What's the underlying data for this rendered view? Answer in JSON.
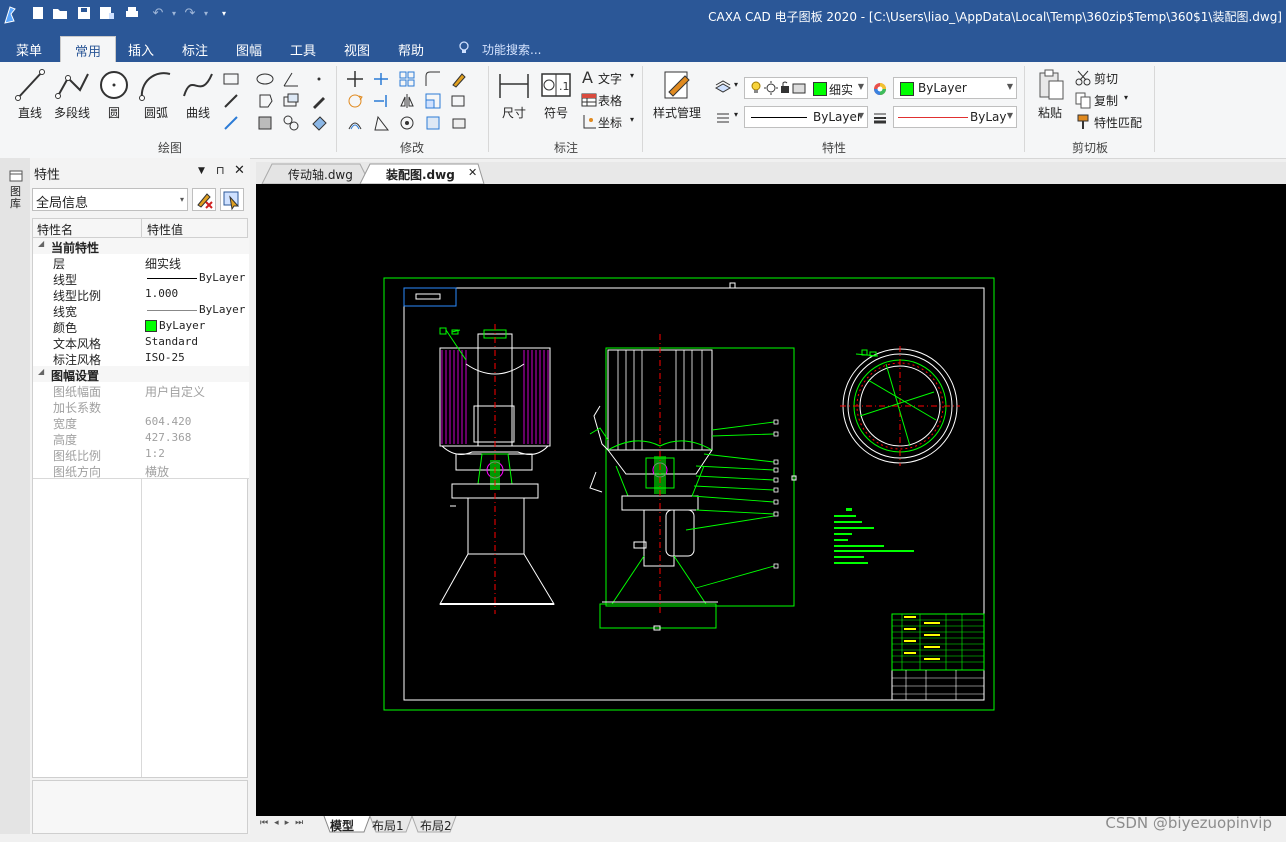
{
  "window": {
    "title": "CAXA CAD 电子图板 2020 - [C:\\Users\\liao_\\AppData\\Local\\Temp\\360zip$Temp\\360$1\\装配图.dwg]"
  },
  "quick_access": [
    "app-logo-icon",
    "new-file-icon",
    "open-folder-icon",
    "save-icon",
    "save-as-icon",
    "print-icon",
    "undo-icon",
    "redo-icon",
    "customize-icon"
  ],
  "menu": {
    "items": [
      "菜单",
      "常用",
      "插入",
      "标注",
      "图幅",
      "工具",
      "视图",
      "帮助"
    ],
    "active": "常用",
    "search_label": "功能搜索..."
  },
  "ribbon": {
    "draw": {
      "label": "绘图",
      "line": "直线",
      "polyline": "多段线",
      "circle": "圆",
      "arc": "圆弧",
      "curve": "曲线"
    },
    "modify": {
      "label": "修改"
    },
    "annotate": {
      "label": "标注",
      "dimension": "尺寸",
      "symbol": "符号",
      "text": "文字",
      "table": "表格",
      "coord": "坐标"
    },
    "properties": {
      "label": "特性",
      "style_manager": "样式管理",
      "layer_name": "细实",
      "color": "ByLayer",
      "linetype": "ByLayer",
      "lineweight": "ByLay"
    },
    "clipboard": {
      "label": "剪切板",
      "paste": "粘贴",
      "cut": "剪切",
      "copy": "复制",
      "match": "特性匹配"
    }
  },
  "colors": {
    "accent": "#2b5797",
    "cad_green": "#00ff00",
    "cad_magenta": "#ff00ff",
    "cad_red": "#ff0000",
    "cad_white": "#ffffff"
  },
  "left_strip": {
    "label": "图库"
  },
  "panel": {
    "title": "特性",
    "filter": "全局信息",
    "col_name": "特性名",
    "col_value": "特性值",
    "rows": [
      {
        "name": "当前特性",
        "value": ""
      },
      {
        "name": "层",
        "value": "细实线"
      },
      {
        "name": "线型",
        "value": "ByLayer"
      },
      {
        "name": "线型比例",
        "value": "1.000"
      },
      {
        "name": "线宽",
        "value": "ByLayer"
      },
      {
        "name": "颜色",
        "value": "ByLayer"
      },
      {
        "name": "文本风格",
        "value": "Standard"
      },
      {
        "name": "标注风格",
        "value": "ISO-25"
      },
      {
        "name": "图幅设置",
        "value": ""
      },
      {
        "name": "图纸幅面",
        "value": "用户自定义"
      },
      {
        "name": "加长系数",
        "value": ""
      },
      {
        "name": "宽度",
        "value": "604.420"
      },
      {
        "name": "高度",
        "value": "427.368"
      },
      {
        "name": "图纸比例",
        "value": "1:2"
      },
      {
        "name": "图纸方向",
        "value": "横放"
      }
    ]
  },
  "doc_tabs": [
    "传动轴.dwg",
    "装配图.dwg"
  ],
  "layout_tabs": [
    "模型",
    "布局1",
    "布局2"
  ],
  "watermark": "CSDN @biyezuopinvip"
}
